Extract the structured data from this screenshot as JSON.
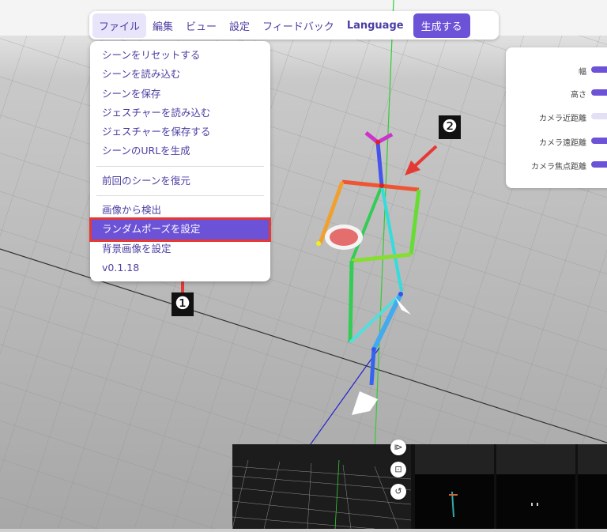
{
  "menubar": {
    "items": [
      "ファイル",
      "編集",
      "ビュー",
      "設定",
      "フィードバック",
      "Language"
    ],
    "generate_label": "生成する"
  },
  "file_menu": {
    "items": [
      "シーンをリセットする",
      "シーンを読み込む",
      "シーンを保存",
      "ジェスチャーを読み込む",
      "ジェスチャーを保存する",
      "シーンのURLを生成"
    ],
    "restore_label": "前回のシーンを復元",
    "detect_label": "画像から検出",
    "random_pose_label": "ランダムポーズを設定",
    "background_label": "背景画像を設定",
    "version": "v0.1.18"
  },
  "settings_panel": {
    "rows": [
      {
        "label": "幅",
        "level": "filled"
      },
      {
        "label": "高さ",
        "level": "filled"
      },
      {
        "label": "カメラ近距離",
        "level": "light"
      },
      {
        "label": "カメラ遠距離",
        "level": "filled"
      },
      {
        "label": "カメラ焦点距離",
        "level": "filled"
      }
    ]
  },
  "annotations": {
    "callout_1": "❶",
    "callout_2": "❷"
  },
  "mini_controls": [
    "⧐",
    "⊡",
    "↺"
  ],
  "colors": {
    "accent": "#6b52d6",
    "accent_text": "#4b3fa3",
    "highlight_outline": "#e53935"
  }
}
